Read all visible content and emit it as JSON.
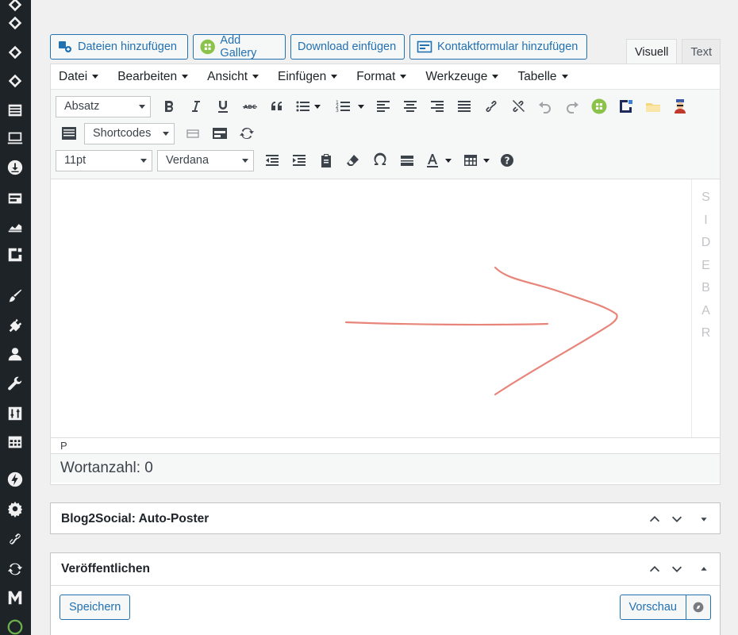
{
  "media_buttons": [
    {
      "label": "Dateien hinzufügen",
      "icon": "add-media-icon"
    },
    {
      "label": "Add Gallery",
      "icon": "gallery-icon"
    },
    {
      "label": "Download einfügen",
      "icon": ""
    },
    {
      "label": "Kontaktformular hinzufügen",
      "icon": "contact-form-icon"
    }
  ],
  "tabs": {
    "visual": "Visuell",
    "text": "Text"
  },
  "menubar": [
    "Datei",
    "Bearbeiten",
    "Ansicht",
    "Einfügen",
    "Format",
    "Werkzeuge",
    "Tabelle"
  ],
  "toolbar": {
    "block_format": "Absatz",
    "shortcodes": "Shortcodes",
    "font_size": "11pt",
    "font_family": "Verdana"
  },
  "sidebar_letters": [
    "S",
    "I",
    "D",
    "E",
    "B",
    "A",
    "R"
  ],
  "path": "P",
  "word_count": "Wortanzahl: 0",
  "boxes": {
    "blog2social": {
      "title": "Blog2Social: Auto-Poster"
    },
    "publish": {
      "title": "Veröffentlichen",
      "save_label": "Speichern",
      "preview_label": "Vorschau"
    }
  },
  "colors": {
    "accent": "#2271b1",
    "admin_bg": "#1d2327",
    "arrow": "#e8857a"
  }
}
